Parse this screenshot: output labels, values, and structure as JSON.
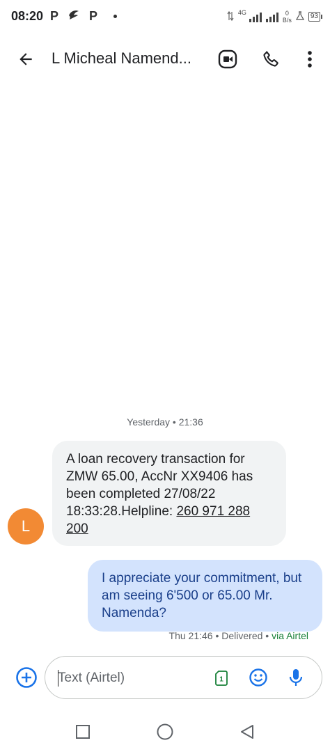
{
  "status_bar": {
    "time": "08:20",
    "app_icons": [
      "P",
      "P"
    ],
    "network": "4G",
    "speed_value": "0",
    "speed_unit": "B/s",
    "battery": "93"
  },
  "app_bar": {
    "title": "L Micheal Namend..."
  },
  "conversation": {
    "timestamp": "Yesterday • 21:36",
    "incoming": {
      "avatar_letter": "L",
      "text": "A loan recovery transaction for ZMW 65.00, AccNr XX9406 has been completed 27/08/22 18:33:28.Helpline: ",
      "phone_link": "260 971 288 200"
    },
    "outgoing": {
      "text": "I appreciate your commitment, but am seeing 6'500 or 65.00 Mr. Namenda?",
      "status": "Thu 21:46 • Delivered • ",
      "carrier": "via Airtel"
    }
  },
  "compose": {
    "placeholder": "Text (Airtel)",
    "sim_label": "1"
  },
  "colors": {
    "accent": "#1a73e8",
    "incoming_bubble": "#f1f3f4",
    "outgoing_bubble": "#d3e3fd",
    "outgoing_text": "#1a3f8a",
    "avatar": "#f28a34",
    "carrier": "#188038"
  },
  "icons": {
    "back": "arrow-left-icon",
    "video": "video-call-icon",
    "call": "phone-icon",
    "more": "more-vert-icon",
    "add": "plus-circle-icon",
    "sim": "sim-card-icon",
    "emoji": "emoji-icon",
    "mic": "microphone-icon",
    "nav_recents": "square-icon",
    "nav_home": "circle-icon",
    "nav_back": "triangle-back-icon"
  }
}
